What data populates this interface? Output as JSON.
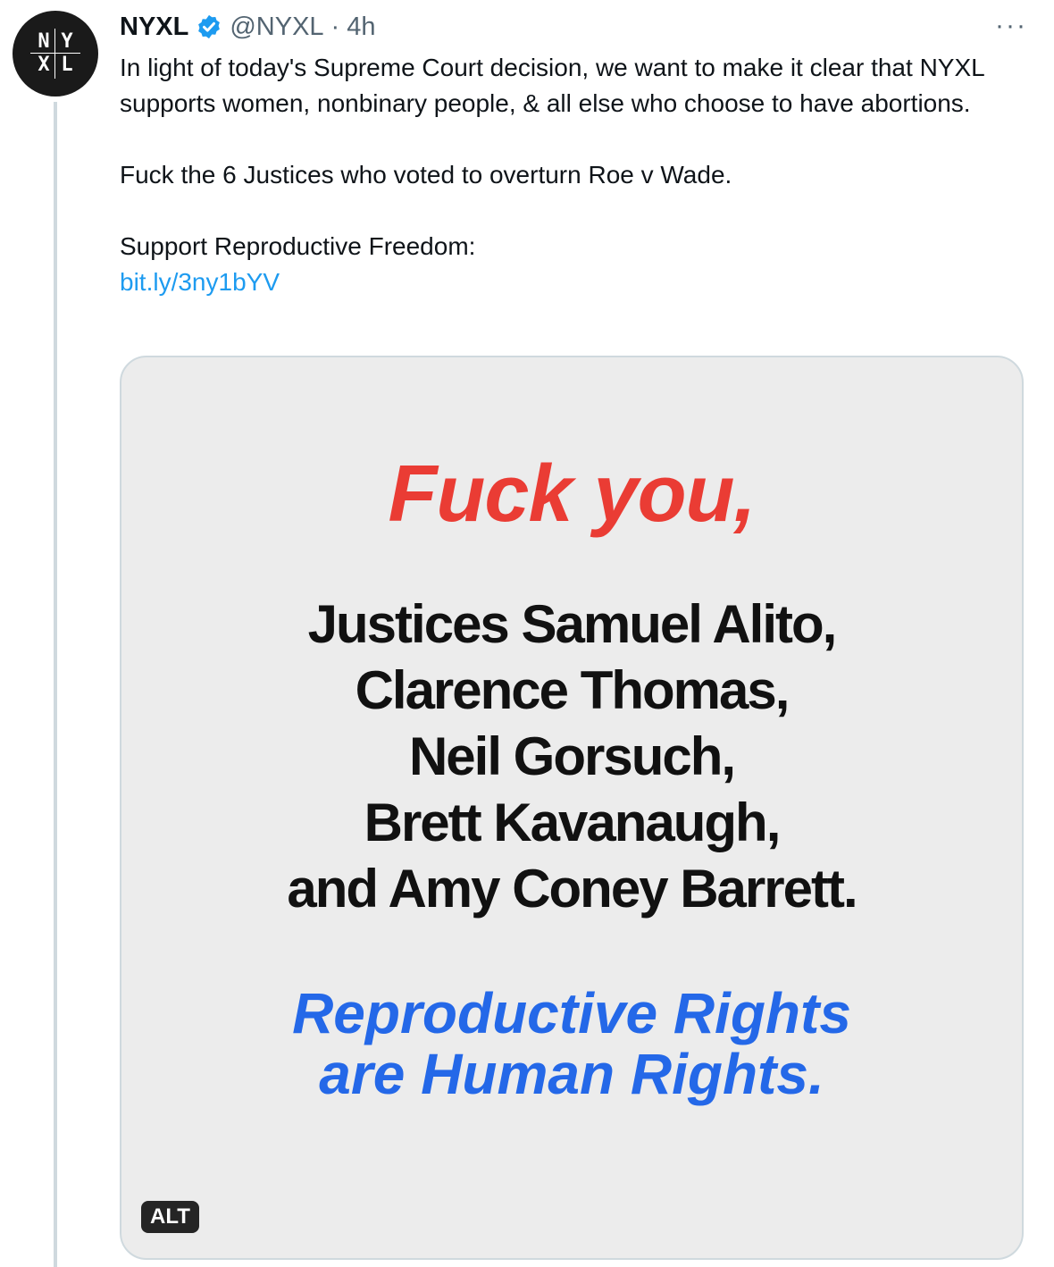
{
  "account": {
    "logo_letters": [
      "N",
      "Y",
      "X",
      "L"
    ],
    "name": "NYXL",
    "handle": "@NYXL",
    "separator": "·",
    "time": "4h",
    "verified": true,
    "icons": {
      "verified": "verified-badge-icon",
      "more": "more-icon"
    }
  },
  "tweet": {
    "paragraph1": "In light of today's Supreme Court decision, we want to make it clear that NYXL supports women, nonbinary people, & all else who choose to have abortions.",
    "paragraph2": "Fuck the 6 Justices who voted to overturn Roe v Wade.",
    "paragraph3": "Support Reproductive Freedom:",
    "link": "bit.ly/3ny1bYV"
  },
  "media": {
    "headline": "Fuck you,",
    "names": [
      "Justices Samuel Alito,",
      "Clarence Thomas,",
      "Neil Gorsuch,",
      "Brett Kavanaugh,",
      "and Amy Coney Barrett."
    ],
    "slogan_line1": "Reproductive Rights",
    "slogan_line2": "are Human Rights.",
    "alt_label": "ALT"
  },
  "more_label": "···",
  "colors": {
    "link": "#1d9bf0",
    "headline": "#ea3c34",
    "slogan": "#2468e8",
    "verified": "#1d9bf0"
  }
}
